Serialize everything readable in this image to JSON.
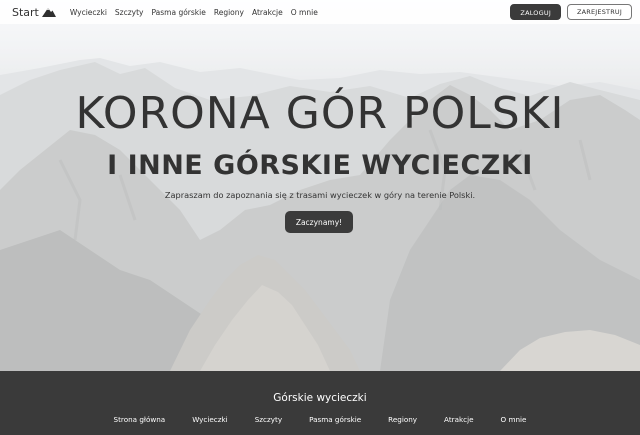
{
  "navbar": {
    "brand": "Start",
    "links": [
      "Wycieczki",
      "Szczyty",
      "Pasma górskie",
      "Regiony",
      "Atrakcje",
      "O mnie"
    ],
    "login_label": "ZALOGUJ",
    "register_label": "ZAREJESTRUJ"
  },
  "hero": {
    "title": "KORONA GÓR POLSKI",
    "subtitle": "I INNE GÓRSKIE WYCIECZKI",
    "description": "Zapraszam do zapoznania się z trasami wycieczek w góry na terenie Polski.",
    "cta_label": "Zaczynamy!"
  },
  "footer": {
    "title": "Górskie wycieczki",
    "links": [
      "Strona główna",
      "Wycieczki",
      "Szczyty",
      "Pasma górskie",
      "Regiony",
      "Atrakcje",
      "O mnie"
    ]
  },
  "colors": {
    "dark_button": "#3b3b3b",
    "footer_bg": "#3a3a3a",
    "text": "#333333"
  }
}
